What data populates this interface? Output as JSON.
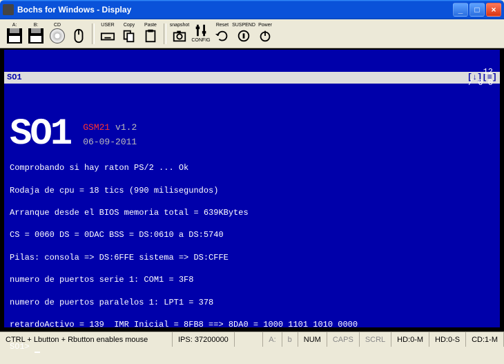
{
  "window": {
    "title": "Bochs for Windows - Display"
  },
  "toolbar": {
    "a": "A:",
    "b": "B:",
    "cd": "CD",
    "mouse": "",
    "user": "USER",
    "copy": "Copy",
    "paste": "Paste",
    "snapshot": "snapshot",
    "config": "CONFIG",
    "reset": "Reset",
    "suspend": "SUSPEND",
    "power": "Power"
  },
  "top": {
    "so1": "SO1",
    "arrows": "[↓][≡]",
    "right_count": "12",
    "right_slash": "/ 0 0"
  },
  "logo": {
    "text": "SO1",
    "line1a": "GSM21",
    "line1b": " v1.2",
    "line2": "06-09-2011"
  },
  "lines": [
    "Comprobando si hay raton PS/2 ... Ok",
    "",
    "Rodaja de cpu = 18 tics (990 milisegundos)",
    "",
    "Arranque desde el BIOS memoria total = 639KBytes",
    "",
    "CS = 0060 DS = 0DAC BSS = DS:0610 a DS:5740",
    "",
    "Pilas: consola => DS:6FFE sistema => DS:CFFE",
    "",
    "numero de puertos serie 1: COM1 = 3F8",
    "",
    "numero de puertos paralelos 1: LPT1 = 378",
    "",
    "retardoActivo = 139  IMR Inicial = 8FB8 ==> 8DA0 = 1000 1101 1010 0000"
  ],
  "prompt": "SO1> ",
  "status": {
    "mouse": "CTRL + Lbutton + Rbutton enables mouse",
    "ips_label": "IPS:",
    "ips": "37200000",
    "a_off": "A:",
    "b": "b",
    "num": "NUM",
    "caps": "CAPS",
    "scrl": "SCRL",
    "hd0m": "HD:0-M",
    "hd0s": "HD:0-S",
    "cd1m": "CD:1-M"
  }
}
